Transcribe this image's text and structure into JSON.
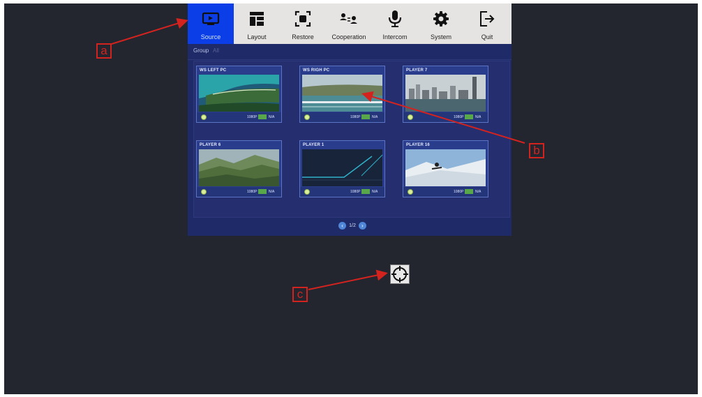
{
  "toolbar": {
    "items": [
      {
        "label": "Source",
        "icon": "source-icon",
        "active": true
      },
      {
        "label": "Layout",
        "icon": "layout-icon",
        "active": false
      },
      {
        "label": "Restore",
        "icon": "restore-icon",
        "active": false
      },
      {
        "label": "Cooperation",
        "icon": "cooperation-icon",
        "active": false
      },
      {
        "label": "Intercom",
        "icon": "microphone-icon",
        "active": false
      },
      {
        "label": "System",
        "icon": "gear-icon",
        "active": false
      },
      {
        "label": "Quit",
        "icon": "exit-icon",
        "active": false
      }
    ]
  },
  "panel": {
    "group_label": "Group",
    "group_value": "All",
    "cards": [
      {
        "title": "WS LEFT PC",
        "thumbnail": "coastline",
        "resolution": "1080P",
        "status": "N/A"
      },
      {
        "title": "WS RIGH PC",
        "thumbnail": "lake-shore",
        "resolution": "1080P",
        "status": "N/A"
      },
      {
        "title": "PLAYER 7",
        "thumbnail": "city-skyline",
        "resolution": "1080P",
        "status": "N/A"
      },
      {
        "title": "PLAYER 6",
        "thumbnail": "mountains",
        "resolution": "1080P",
        "status": "N/A"
      },
      {
        "title": "PLAYER 1",
        "thumbnail": "dark-lines",
        "resolution": "1080P",
        "status": "N/A"
      },
      {
        "title": "PLAYER 16",
        "thumbnail": "snowboarder",
        "resolution": "1080P",
        "status": "N/A"
      }
    ],
    "pager": {
      "text": "1/2",
      "prev_icon": "chevron-left-icon",
      "next_icon": "chevron-right-icon"
    }
  },
  "cursor": {
    "icon": "crosshair-icon"
  },
  "annotations": {
    "a": "a",
    "b": "b",
    "c": "c"
  },
  "colors": {
    "background": "#23262f",
    "toolbar": "#e6e4e3",
    "active_tab": "#0b3ee6",
    "panel": "#1f2a68",
    "card": "#2a3c8c",
    "annotation": "#d3231f",
    "status_green": "#58a84b"
  }
}
